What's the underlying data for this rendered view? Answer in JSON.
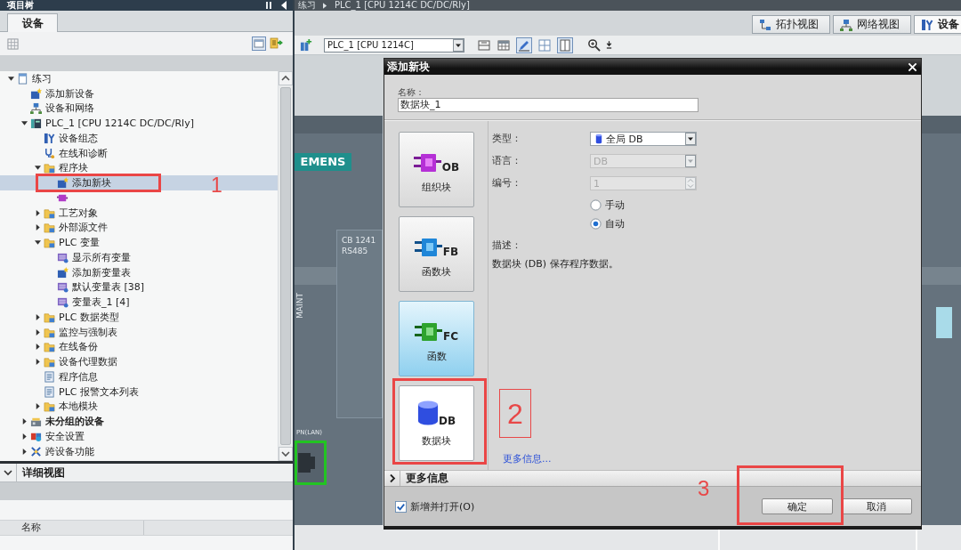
{
  "project_tree": {
    "title": "项目树",
    "tabs": [
      {
        "label": "设备",
        "selected": true
      }
    ],
    "tree": [
      {
        "label": "练习",
        "kind": "project",
        "expanded": true,
        "selected": false,
        "children": [
          {
            "label": "添加新设备",
            "kind": "add",
            "selected": false
          },
          {
            "label": "设备和网络",
            "kind": "network",
            "selected": false
          },
          {
            "label": "PLC_1 [CPU 1214C DC/DC/Rly]",
            "kind": "plc",
            "expanded": true,
            "selected": false,
            "children": [
              {
                "label": "设备组态",
                "kind": "config",
                "selected": false
              },
              {
                "label": "在线和诊断",
                "kind": "diagnostics",
                "selected": false
              },
              {
                "label": "程序块",
                "kind": "folder",
                "expanded": true,
                "selected": false,
                "children": [
                  {
                    "label": "添加新块",
                    "kind": "add",
                    "selected": true
                  },
                  {
                    "kind": "block",
                    "selected": false
                  }
                ]
              },
              {
                "label": "工艺对象",
                "kind": "folder",
                "expanded": false,
                "selected": false
              },
              {
                "label": "外部源文件",
                "kind": "folder",
                "expanded": false,
                "selected": false
              },
              {
                "label": "PLC 变量",
                "kind": "folder",
                "expanded": true,
                "selected": false,
                "children": [
                  {
                    "label": "显示所有变量",
                    "kind": "tags",
                    "selected": false
                  },
                  {
                    "label": "添加新变量表",
                    "kind": "add",
                    "selected": false
                  },
                  {
                    "label": "默认变量表 [38]",
                    "kind": "tags",
                    "selected": false
                  },
                  {
                    "label": "变量表_1 [4]",
                    "kind": "tags",
                    "selected": false
                  }
                ]
              },
              {
                "label": "PLC 数据类型",
                "kind": "folder",
                "expanded": false,
                "selected": false
              },
              {
                "label": "监控与强制表",
                "kind": "folder",
                "expanded": false,
                "selected": false
              },
              {
                "label": "在线备份",
                "kind": "folder",
                "expanded": false,
                "selected": false
              },
              {
                "label": "设备代理数据",
                "kind": "folder",
                "expanded": false,
                "selected": false
              },
              {
                "label": "程序信息",
                "kind": "list",
                "selected": false
              },
              {
                "label": "PLC 报警文本列表",
                "kind": "list",
                "selected": false
              },
              {
                "label": "本地模块",
                "kind": "folder",
                "expanded": false,
                "selected": false
              }
            ]
          },
          {
            "label": "未分组的设备",
            "kind": "devices",
            "bold": true,
            "expanded": false,
            "selected": false
          },
          {
            "label": "安全设置",
            "kind": "security",
            "expanded": false,
            "selected": false
          },
          {
            "label": "跨设备功能",
            "kind": "cross-device",
            "expanded": false,
            "selected": false
          }
        ]
      }
    ],
    "detail_view": {
      "title": "详细视图",
      "expanded": true,
      "columns": [
        "名称"
      ]
    }
  },
  "editor": {
    "breadcrumb": [
      "练习",
      "PLC_1 [CPU 1214C DC/DC/Rly]"
    ],
    "view_tabs": [
      {
        "label": "拓扑视图",
        "kind": "topology",
        "selected": false
      },
      {
        "label": "网络视图",
        "kind": "network",
        "selected": false
      },
      {
        "label": "设备",
        "kind": "device",
        "selected": true
      }
    ],
    "device_selector": {
      "value": "PLC_1 [CPU 1214C]"
    },
    "device_view": {
      "brand": "EMENS",
      "module_lines": [
        "CB 1241",
        "RS485"
      ],
      "status_led": "MAINT",
      "port_label": "PN(LAN)"
    }
  },
  "dialog": {
    "title": "添加新块",
    "name_label": "名称：",
    "name_value": "数据块_1",
    "block_types": [
      {
        "label": "组织块",
        "badge": "OB",
        "kind": "ob",
        "selected": false,
        "hovered": false
      },
      {
        "label": "函数块",
        "badge": "FB",
        "kind": "fb",
        "selected": false,
        "hovered": false
      },
      {
        "label": "函数",
        "badge": "FC",
        "kind": "fc",
        "selected": false,
        "hovered": true
      },
      {
        "label": "数据块",
        "badge": "DB",
        "kind": "db",
        "selected": true,
        "hovered": false
      }
    ],
    "fields": [
      {
        "label": "类型：",
        "kind": "typed-dropdown",
        "value": "全局 DB",
        "disabled": false
      },
      {
        "label": "语言：",
        "kind": "dropdown",
        "value": "DB",
        "disabled": true
      },
      {
        "label": "编号：",
        "kind": "spinner",
        "value": "1",
        "disabled": true
      }
    ],
    "number_mode": [
      {
        "label": "手动",
        "selected": false
      },
      {
        "label": "自动",
        "selected": true
      }
    ],
    "description_label": "描述：",
    "description": "数据块 (DB) 保存程序数据。",
    "more_info_link": "更多信息...",
    "more_info_section": {
      "label": "更多信息",
      "expanded": false
    },
    "add_and_open": {
      "label": "新增并打开(O)",
      "checked": true
    },
    "buttons": [
      "确定",
      "取消"
    ]
  },
  "annotations": [
    {
      "label": "1"
    },
    {
      "label": "2"
    },
    {
      "label": "3"
    }
  ]
}
